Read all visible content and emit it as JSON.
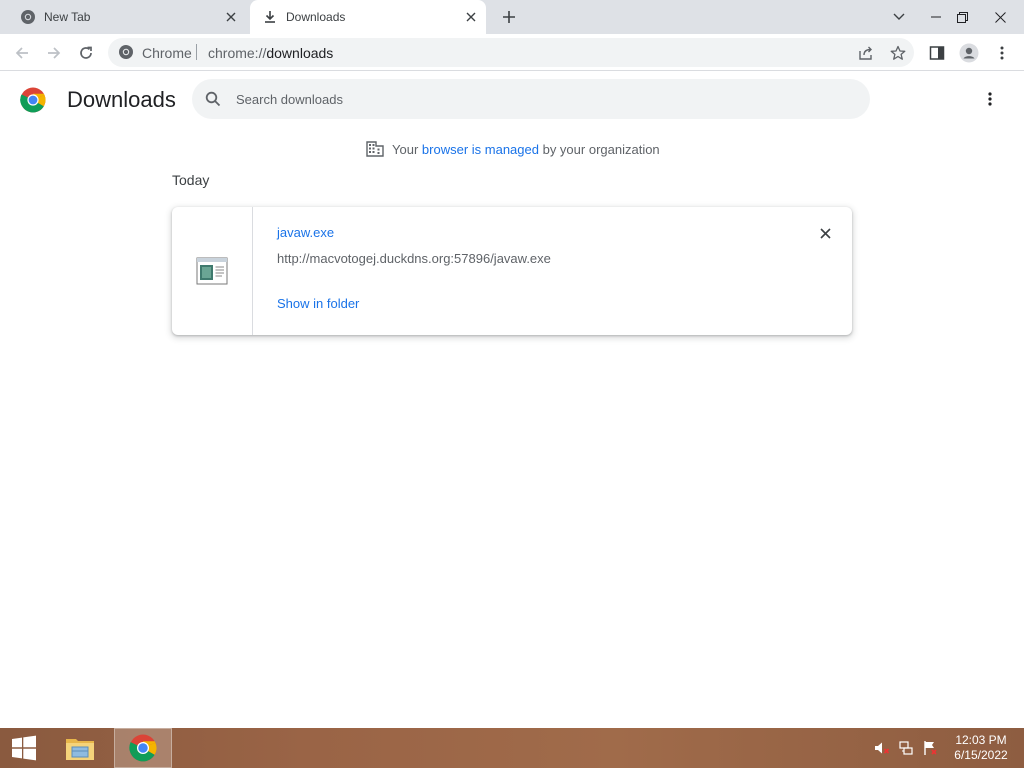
{
  "tabs": [
    {
      "title": "New Tab",
      "icon": "chrome-icon",
      "active": false
    },
    {
      "title": "Downloads",
      "icon": "download-icon",
      "active": true
    }
  ],
  "omnibox": {
    "chip": "Chrome",
    "scheme": "chrome://",
    "host": "downloads"
  },
  "page": {
    "title": "Downloads",
    "search_placeholder": "Search downloads",
    "managed": {
      "prefix": "Your",
      "link": "browser is managed",
      "suffix": "by your organization"
    },
    "date_heading": "Today",
    "downloads": [
      {
        "file_name": "javaw.exe",
        "url": "http://macvotogej.duckdns.org:57896/javaw.exe",
        "action": "Show in folder"
      }
    ]
  },
  "taskbar": {
    "time": "12:03 PM",
    "date": "6/15/2022",
    "apps": [
      "file-explorer",
      "chrome"
    ]
  },
  "colors": {
    "link_blue": "#1a73e8",
    "tabstrip_bg": "#dee1e6",
    "omnibox_bg": "#f1f3f4",
    "taskbar_brown": "#9a6446"
  }
}
